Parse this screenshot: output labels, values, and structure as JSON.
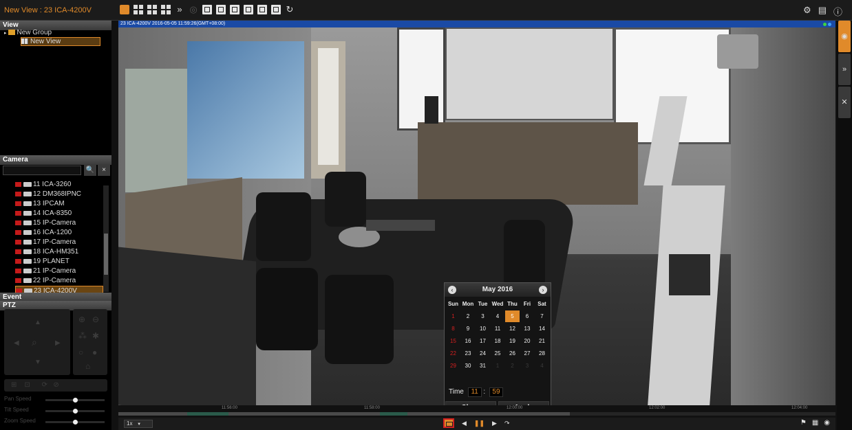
{
  "window": {
    "title": "New View : 23 ICA-4200V"
  },
  "toolbar": {
    "more_glyph": "»",
    "refresh_glyph": "↻",
    "top_right_icons": [
      "gear-icon",
      "document-icon",
      "info-icon"
    ]
  },
  "view_panel": {
    "header": "View",
    "group": "New Group",
    "view": "New View"
  },
  "camera_panel": {
    "header": "Camera",
    "search_placeholder": "",
    "search_btn": "🔍",
    "clear_btn": "×",
    "cameras": [
      "11 ICA-3260",
      "12 DM368IPNC",
      "13 IPCAM",
      "14 ICA-8350",
      "15 IP-Camera",
      "16 ICA-1200",
      "17 IP-Camera",
      "18 ICA-HM351",
      "19 PLANET",
      "21 IP-Camera",
      "22 IP-Camera",
      "23 ICA-4200V"
    ],
    "selected": "23 ICA-4200V"
  },
  "event_panel": {
    "header": "Event"
  },
  "ptz_panel": {
    "header": "PTZ",
    "speeds": [
      {
        "label": "Pan Speed",
        "value": 0.5
      },
      {
        "label": "Tilt Speed",
        "value": 0.5
      },
      {
        "label": "Zoom Speed",
        "value": 0.5
      }
    ]
  },
  "video": {
    "header": "23 ICA-4200V  2016-05-05 11:59:26(GMT+08:00)",
    "status_colors": [
      "#3fd43f",
      "#3fa0ff"
    ]
  },
  "calendar": {
    "month_label": "May 2016",
    "weekdays": [
      "Sun",
      "Mon",
      "Tue",
      "Wed",
      "Thu",
      "Fri",
      "Sat"
    ],
    "weeks": [
      [
        "1",
        "2",
        "3",
        "4",
        "5",
        "6",
        "7"
      ],
      [
        "8",
        "9",
        "10",
        "11",
        "12",
        "13",
        "14"
      ],
      [
        "15",
        "16",
        "17",
        "18",
        "19",
        "20",
        "21"
      ],
      [
        "22",
        "23",
        "24",
        "25",
        "26",
        "27",
        "28"
      ],
      [
        "29",
        "30",
        "31",
        "1",
        "2",
        "3",
        "4"
      ]
    ],
    "today": "5",
    "time_label": "Time",
    "hour": "11",
    "sep": ":",
    "minute": "59",
    "close_label": "Close",
    "apply_label": "Apply"
  },
  "timeline": {
    "ticks": [
      "11:56:00",
      "11:58:00",
      "12:00:00",
      "12:02:00",
      "12:04:00"
    ],
    "progress": 0.63
  },
  "playback": {
    "speed": "1x",
    "prev": "◀",
    "pause": "❚❚",
    "next": "▶",
    "return": "↷"
  },
  "colors": {
    "accent": "#e08a2a",
    "header_blue": "#1a4aa5",
    "rec_red": "#c41a1a"
  }
}
